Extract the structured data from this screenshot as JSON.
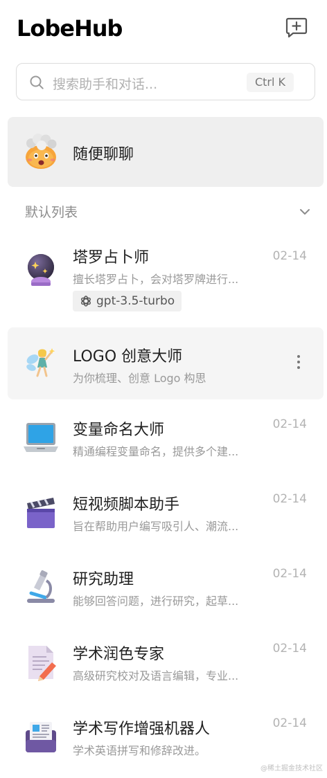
{
  "header": {
    "logo": "LobeHub"
  },
  "search": {
    "placeholder": "搜索助手和对话...",
    "shortcut": "Ctrl K"
  },
  "random_chat": {
    "label": "随便聊聊"
  },
  "group": {
    "title": "默认列表"
  },
  "items": [
    {
      "title": "塔罗占卜师",
      "desc": "擅长塔罗占卜，会对塔罗牌进行...",
      "date": "02-14",
      "tag": "gpt-3.5-turbo",
      "icon": "crystal-ball-icon"
    },
    {
      "title": "LOGO 创意大师",
      "desc": "为你梳理、创意 Logo 构思",
      "icon": "fairy-icon"
    },
    {
      "title": "变量命名大师",
      "desc": "精通编程变量命名，提供多个建...",
      "date": "02-14",
      "icon": "laptop-icon"
    },
    {
      "title": "短视频脚本助手",
      "desc": "旨在帮助用户编写吸引人、潮流...",
      "date": "02-14",
      "icon": "clapper-board-icon"
    },
    {
      "title": "研究助理",
      "desc": "能够回答问题，进行研究，起草...",
      "date": "02-14",
      "icon": "microscope-icon"
    },
    {
      "title": "学术润色专家",
      "desc": "高级研究校对及语言编辑，专业...",
      "date": "02-14",
      "icon": "memo-icon"
    },
    {
      "title": "学术写作增强机器人",
      "desc": "学术英语拼写和修辞改进。",
      "date": "02-14",
      "icon": "newspaper-icon"
    }
  ],
  "watermark": "@稀土掘金技术社区"
}
